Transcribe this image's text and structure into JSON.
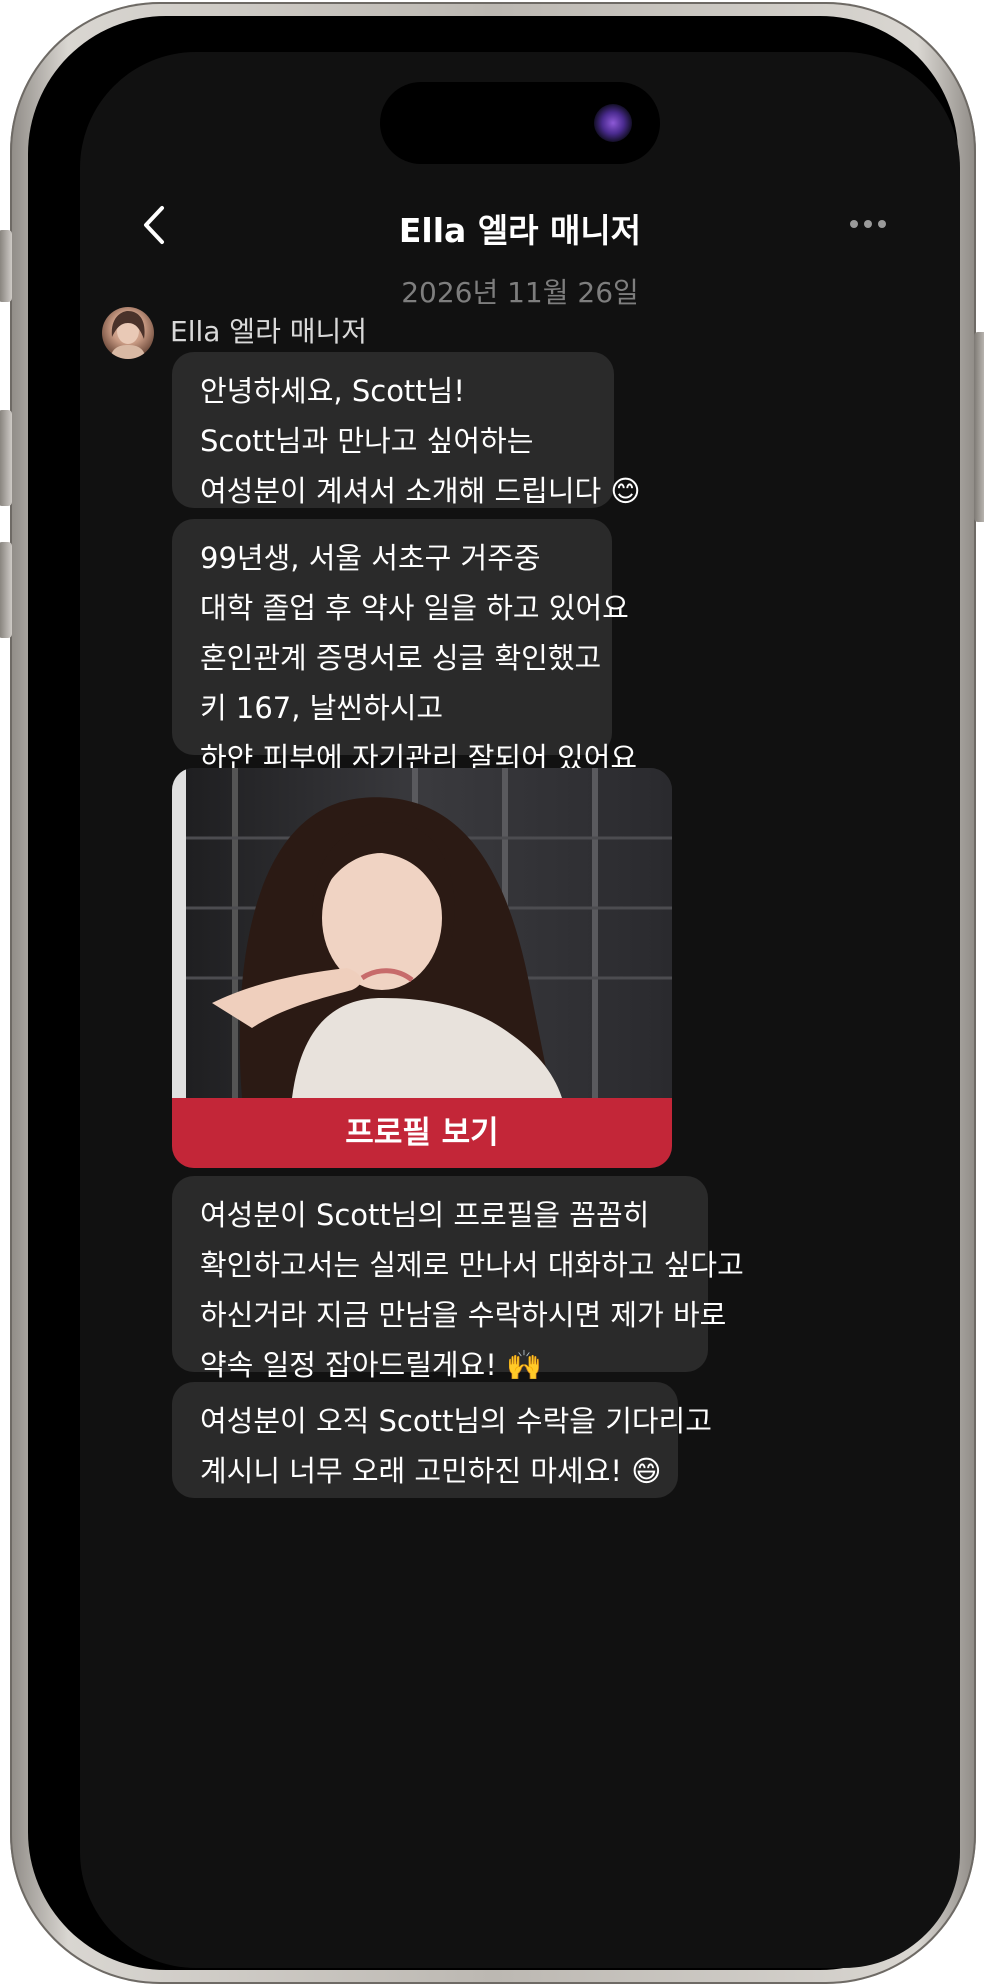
{
  "header": {
    "title": "Ella 엘라 매니저",
    "back_icon": "chevron-left-icon",
    "more_icon": "more-horizontal-icon"
  },
  "date": "2026년 11월 26일",
  "sender": {
    "name": "Ella 엘라 매니저",
    "avatar_icon": "avatar"
  },
  "messages": [
    {
      "lines": [
        "안녕하세요, Scott님!",
        "Scott님과 만나고 싶어하는",
        "여성분이 계셔서 소개해 드립니다 😊"
      ]
    },
    {
      "lines": [
        "99년생, 서울 서초구 거주중",
        "대학 졸업 후 약사 일을 하고 있어요",
        "혼인관계 증명서로 싱글 확인했고",
        "키 167, 날씬하시고",
        "하얀 피부에 자기관리 잘되어 있어요"
      ]
    },
    {
      "lines": [
        "여성분이 Scott님의 프로필을 꼼꼼히",
        "확인하고서는 실제로 만나서 대화하고 싶다고",
        "하신거라 지금 만남을 수락하시면 제가 바로",
        "약속 일정 잡아드릴게요! 🙌"
      ]
    },
    {
      "lines": [
        "여성분이 오직 Scott님의 수락을 기다리고",
        "계시니 너무 오래 고민하진 마세요! 😄"
      ]
    }
  ],
  "profile_card": {
    "button_label": "프로필 보기",
    "button_color": "#c32638"
  },
  "colors": {
    "background": "#111111",
    "bubble": "#2a2a2a",
    "date_text": "#7e7e7e"
  }
}
